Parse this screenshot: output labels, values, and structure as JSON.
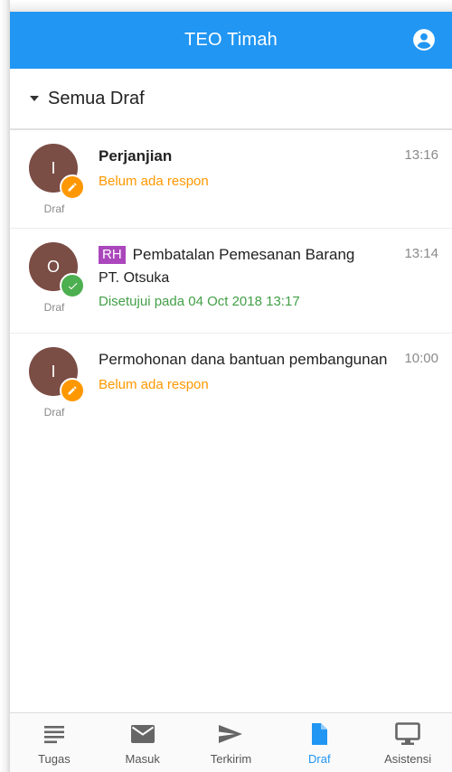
{
  "appbar": {
    "title": "TEO Timah",
    "account_icon": "account-circle-icon"
  },
  "filter": {
    "label": "Semua Draf"
  },
  "drafts": [
    {
      "avatar_letter": "I",
      "avatar_color": "#7a4d45",
      "badge": "pencil-icon",
      "caption": "Draf",
      "subject": "Perjanjian",
      "status": "Belum ada respon",
      "time": "13:16"
    },
    {
      "avatar_letter": "O",
      "avatar_color": "#7a4d45",
      "badge": "check-icon",
      "caption": "Draf",
      "tag": "RH",
      "subject": "Pembatalan Pemesanan Barang",
      "company": "PT. Otsuka",
      "status": "Disetujui pada 04 Oct 2018 13:17",
      "time": "13:14"
    },
    {
      "avatar_letter": "I",
      "avatar_color": "#7a4d45",
      "badge": "pencil-icon",
      "caption": "Draf",
      "subject": "Permohonan dana bantuan pembangunan",
      "status": "Belum ada respon",
      "time": "10:00"
    }
  ],
  "bottomnav": {
    "items": [
      {
        "label": "Tugas",
        "icon": "list-icon"
      },
      {
        "label": "Masuk",
        "icon": "mail-icon"
      },
      {
        "label": "Terkirim",
        "icon": "send-icon"
      },
      {
        "label": "Draf",
        "icon": "file-icon"
      },
      {
        "label": "Asistensi",
        "icon": "monitor-icon"
      }
    ],
    "active": "Draf"
  },
  "colors": {
    "primary": "#2196f3",
    "pending": "#ff9800",
    "approved": "#4caf50",
    "tag": "#ab47bc"
  }
}
